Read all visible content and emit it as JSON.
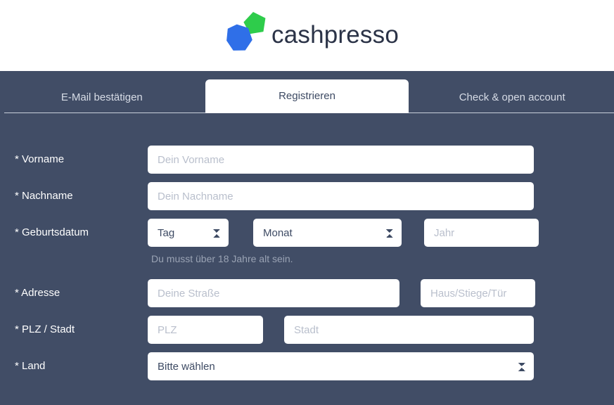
{
  "brand": {
    "name": "cashpresso",
    "mark_green": "#2ecc4b",
    "mark_blue": "#2f6fe8",
    "wordmark_color": "#2b3347"
  },
  "theme": {
    "background": "#414d66",
    "panel_white": "#ffffff",
    "label_color": "#ffffff",
    "placeholder_color": "#b9bfcc",
    "hint_color": "#9aa3b4"
  },
  "tabs": [
    {
      "label": "E-Mail bestätigen",
      "active": false
    },
    {
      "label": "Registrieren",
      "active": true
    },
    {
      "label": "Check & open account",
      "active": false
    }
  ],
  "form": {
    "rows": {
      "first_name": {
        "label": "* Vorname",
        "placeholder": "Dein Vorname",
        "value": ""
      },
      "last_name": {
        "label": "* Nachname",
        "placeholder": "Dein Nachname",
        "value": ""
      },
      "birthdate": {
        "label": "* Geburtsdatum",
        "day_selected": "Tag",
        "month_selected": "Monat",
        "year_placeholder": "Jahr",
        "year_value": "",
        "hint": "Du musst über 18 Jahre alt sein."
      },
      "address": {
        "label": "* Adresse",
        "street_placeholder": "Deine Straße",
        "street_value": "",
        "house_placeholder": "Haus/Stiege/Tür",
        "house_value": ""
      },
      "zip_city": {
        "label": "* PLZ / Stadt",
        "zip_placeholder": "PLZ",
        "zip_value": "",
        "city_placeholder": "Stadt",
        "city_value": ""
      },
      "country": {
        "label": "* Land",
        "selected": "Bitte wählen"
      }
    }
  }
}
